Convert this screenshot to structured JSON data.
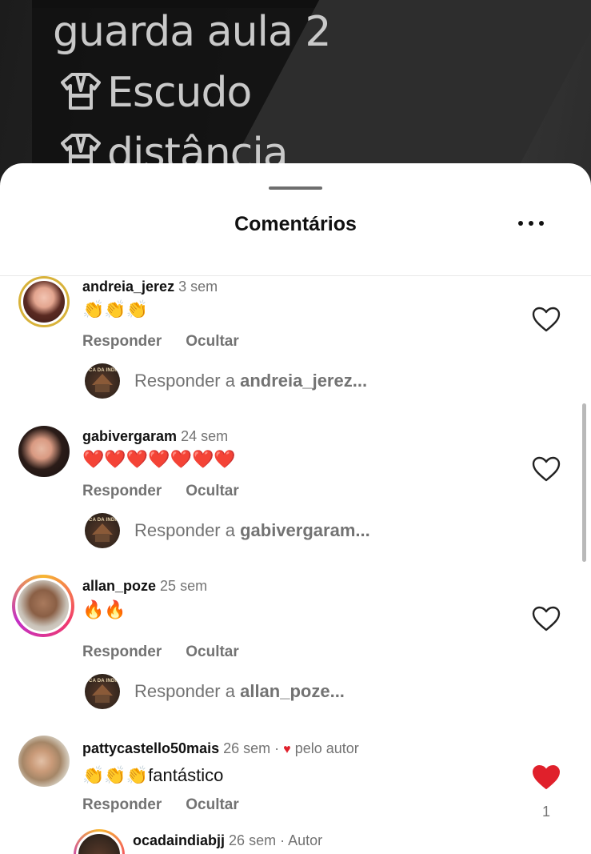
{
  "video": {
    "overlay_lines": [
      "guarda aula 2",
      "Escudo",
      "distância"
    ]
  },
  "sheet": {
    "title": "Comentários",
    "more_icon": "more-horizontal-icon"
  },
  "comments": [
    {
      "username": "andreia_jerez",
      "time": "3 sem",
      "text": "👏👏👏",
      "reply_label": "Responder",
      "hide_label": "Ocultar",
      "reply_prefix": "Responder a ",
      "reply_user": "andreia_jerez...",
      "liked": false
    },
    {
      "username": "gabivergaram",
      "time": "24 sem",
      "text": "❤️❤️❤️❤️❤️❤️❤️",
      "reply_label": "Responder",
      "hide_label": "Ocultar",
      "reply_prefix": "Responder a ",
      "reply_user": "gabivergaram...",
      "liked": false
    },
    {
      "username": "allan_poze",
      "time": "25 sem",
      "text": "🔥🔥",
      "reply_label": "Responder",
      "hide_label": "Ocultar",
      "reply_prefix": "Responder a ",
      "reply_user": "allan_poze...",
      "liked": false
    },
    {
      "username": "pattycastello50mais",
      "time": "26 sem",
      "separator": "·",
      "liked_by_author": "pelo autor",
      "text": "👏👏👏fantástico",
      "reply_label": "Responder",
      "hide_label": "Ocultar",
      "liked": true,
      "like_count": "1"
    }
  ],
  "author_reply": {
    "username": "ocadaindiabjj",
    "time": "26 sem",
    "separator": "·",
    "tag": "Autor"
  },
  "mini_avatar_text": "OCA DA INDIA",
  "colors": {
    "heart_liked": "#e0202b",
    "secondary_text": "#737373",
    "story_ring": [
      "#f7b731",
      "#f23a6c",
      "#c22fc5"
    ],
    "gold_ring": "#d8b23a"
  }
}
